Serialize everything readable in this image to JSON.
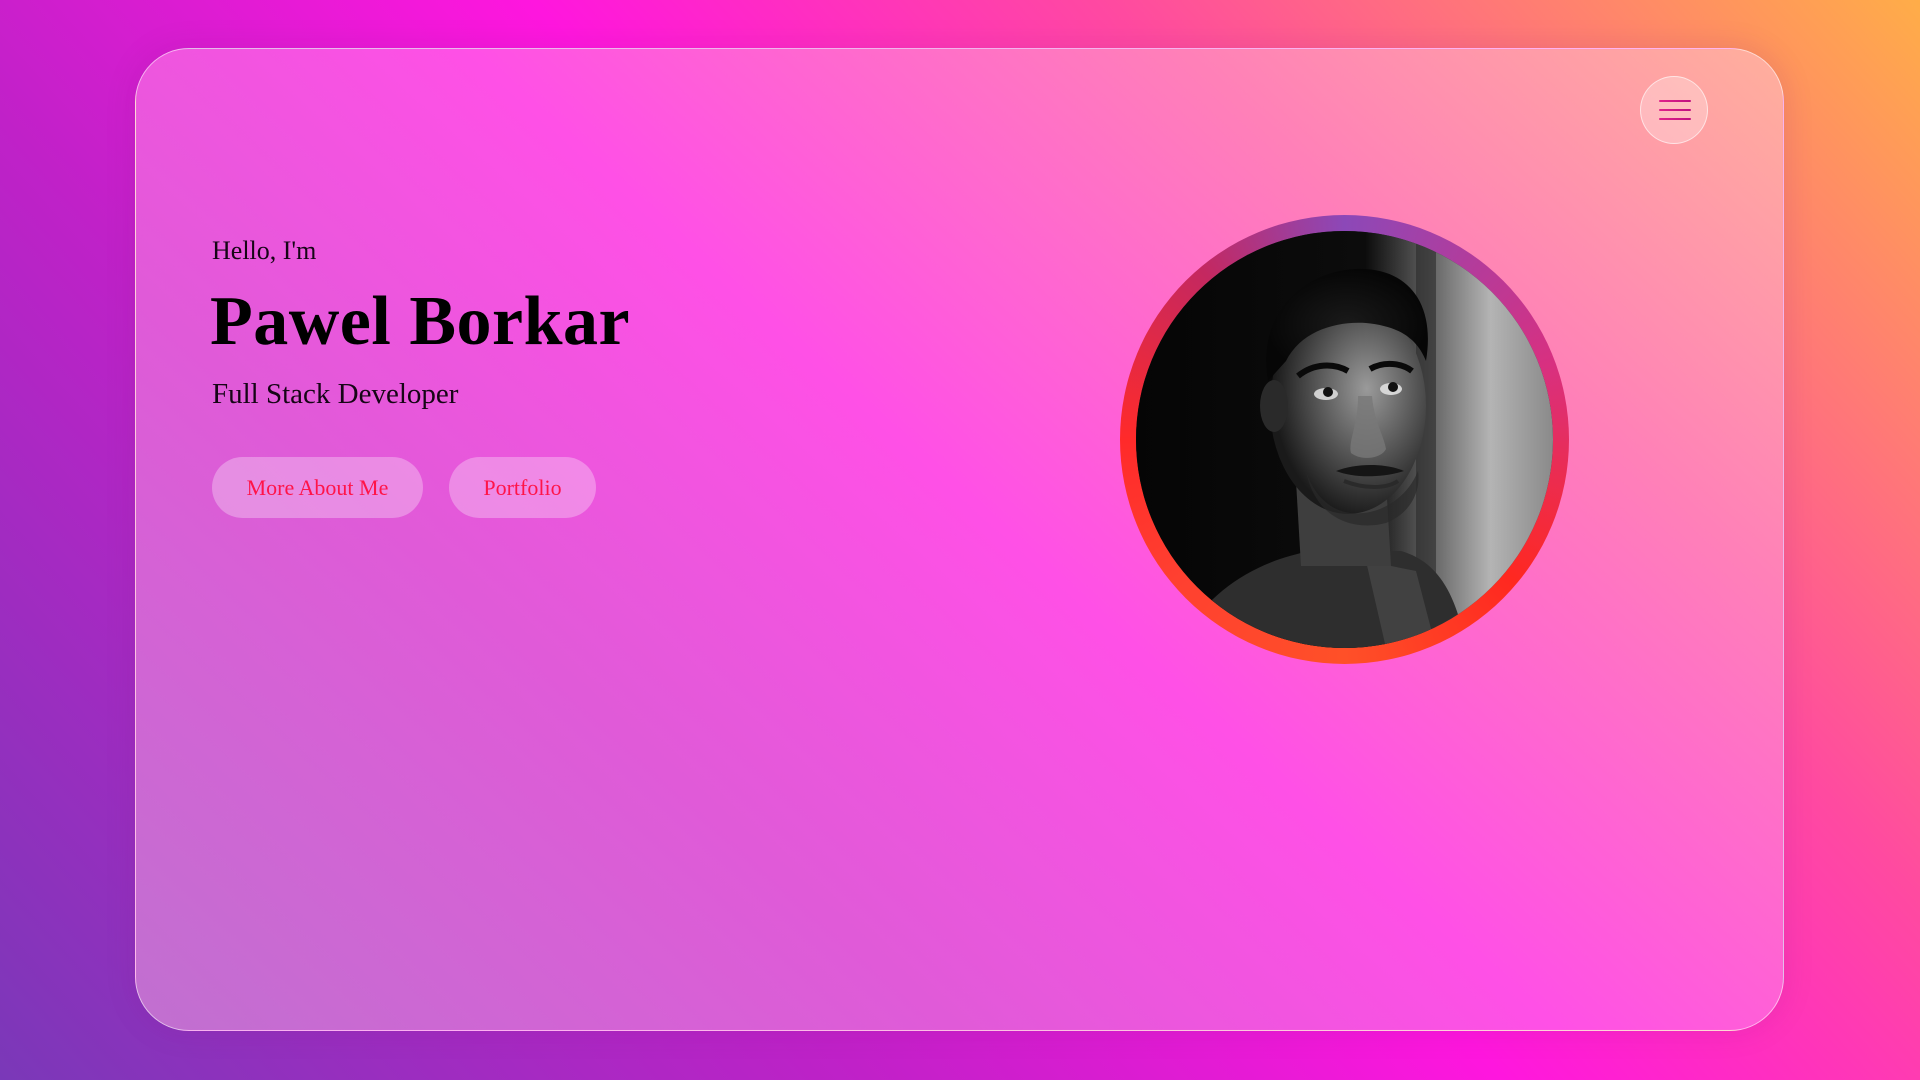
{
  "header": {
    "menu_icon": "hamburger-menu-icon"
  },
  "hero": {
    "greeting": "Hello, I'm",
    "name": "Pawel Borkar",
    "role": "Full Stack Developer",
    "buttons": {
      "about_label": "More About Me",
      "portfolio_label": "Portfolio"
    },
    "avatar_alt": "profile-photo"
  },
  "colors": {
    "button_text": "#ff1448",
    "heading_text": "#000000"
  }
}
